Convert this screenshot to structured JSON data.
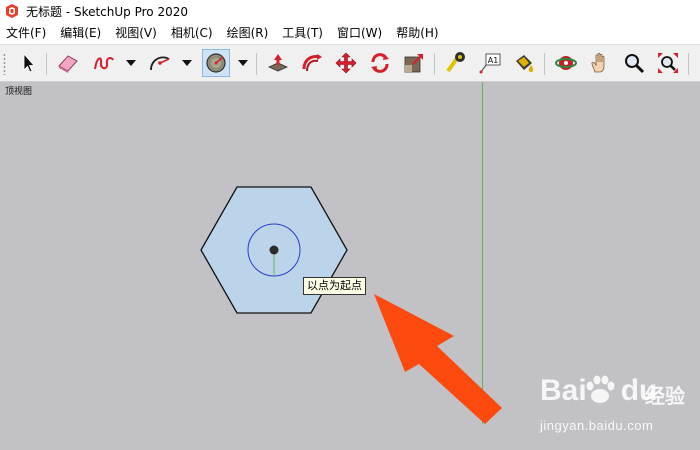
{
  "window": {
    "title": "无标题 - SketchUp Pro 2020"
  },
  "menubar": {
    "items": [
      "文件(F)",
      "编辑(E)",
      "视图(V)",
      "相机(C)",
      "绘图(R)",
      "工具(T)",
      "窗口(W)",
      "帮助(H)"
    ]
  },
  "toolbar": {
    "tools": [
      {
        "name": "select-tool",
        "icon": "arrow-cursor-icon"
      },
      {
        "name": "eraser-tool",
        "icon": "eraser-icon"
      },
      {
        "name": "freehand-tool",
        "icon": "freehand-curve-icon"
      },
      {
        "name": "arc-tool",
        "icon": "arc-icon"
      },
      {
        "name": "polygon-tool",
        "icon": "polygon-icon",
        "active": true
      },
      {
        "name": "push-pull-tool",
        "icon": "push-pull-icon"
      },
      {
        "name": "follow-me-tool",
        "icon": "follow-me-icon"
      },
      {
        "name": "move-tool",
        "icon": "move-arrows-icon"
      },
      {
        "name": "rotate-tool",
        "icon": "rotate-icon"
      },
      {
        "name": "scale-tool",
        "icon": "scale-icon"
      },
      {
        "name": "tape-measure-tool",
        "icon": "tape-measure-icon"
      },
      {
        "name": "text-tool",
        "icon": "text-label-icon",
        "label": "A1"
      },
      {
        "name": "paint-bucket-tool",
        "icon": "paint-bucket-icon"
      },
      {
        "name": "orbit-tool",
        "icon": "orbit-icon"
      },
      {
        "name": "pan-tool",
        "icon": "hand-icon"
      },
      {
        "name": "zoom-tool",
        "icon": "magnifier-icon"
      },
      {
        "name": "zoom-extents-tool",
        "icon": "zoom-extents-icon"
      }
    ]
  },
  "viewport": {
    "view_label": "顶视图",
    "tooltip": "以点为起点"
  },
  "watermark": {
    "brand": "Bai",
    "brand_suffix": "du",
    "cn": "经验",
    "url": "jingyan.baidu.com"
  },
  "colors": {
    "canvas": "#c1c1c6",
    "hexagon_fill": "#bcd4ea",
    "inference_circle": "#2a3ccf",
    "arrow": "#fc4a0e",
    "green_axis": "#5cb85c"
  }
}
